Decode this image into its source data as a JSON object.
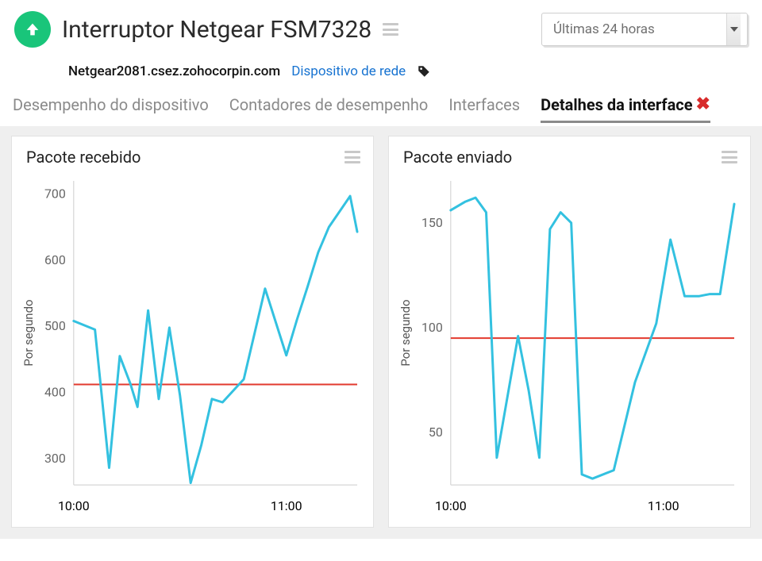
{
  "header": {
    "title": "Interruptor Netgear FSM7328",
    "host": "Netgear2081.csez.zohocorpin.com",
    "device_type_label": "Dispositivo de rede",
    "status": "up",
    "time_range_selected": "Últimas 24 horas"
  },
  "tabs": [
    {
      "label": "Desempenho do dispositivo",
      "active": false
    },
    {
      "label": "Contadores de desempenho",
      "active": false
    },
    {
      "label": "Interfaces",
      "active": false
    },
    {
      "label": "Detalhes da interface",
      "active": true,
      "closable": true
    }
  ],
  "chart_data": [
    {
      "type": "line",
      "title": "Pacote recebido",
      "ylabel": "Por segundo",
      "ylim": [
        260,
        720
      ],
      "yticks": [
        300,
        400,
        500,
        600,
        700
      ],
      "xticks": [
        "10:00",
        "11:00"
      ],
      "xtick_positions": [
        608,
        668
      ],
      "threshold_y": 412,
      "series": [
        {
          "name": "recv",
          "x": [
            608,
            614,
            618,
            621,
            624,
            626,
            629,
            632,
            635,
            638,
            641,
            644,
            647,
            650,
            656,
            662,
            668,
            671,
            674,
            677,
            680,
            686,
            688
          ],
          "values": [
            508,
            495,
            286,
            455,
            413,
            378,
            524,
            390,
            498,
            395,
            263,
            320,
            390,
            385,
            420,
            557,
            456,
            510,
            560,
            612,
            650,
            697,
            643
          ]
        }
      ]
    },
    {
      "type": "line",
      "title": "Pacote enviado",
      "ylabel": "Por segundo",
      "ylim": [
        25,
        170
      ],
      "yticks": [
        50,
        100,
        150
      ],
      "xticks": [
        "10:00",
        "11:00"
      ],
      "xtick_positions": [
        608,
        668
      ],
      "threshold_y": 95,
      "series": [
        {
          "name": "sent",
          "x": [
            608,
            612,
            615,
            618,
            621,
            624,
            627,
            630,
            633,
            636,
            639,
            642,
            645,
            648,
            654,
            660,
            666,
            670,
            674,
            678,
            681,
            684,
            688
          ],
          "values": [
            156,
            160,
            162,
            155,
            38,
            67,
            96,
            70,
            38,
            147,
            155,
            150,
            30,
            28,
            32,
            74,
            102,
            142,
            115,
            115,
            116,
            116,
            159
          ]
        }
      ]
    }
  ]
}
